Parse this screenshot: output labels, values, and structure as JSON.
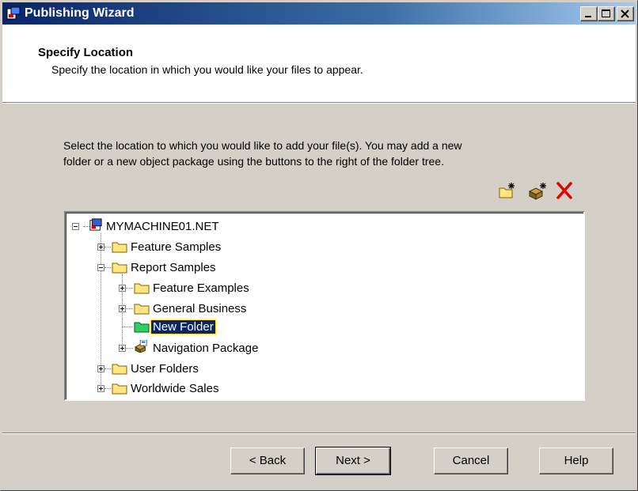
{
  "window": {
    "title": "Publishing Wizard"
  },
  "header": {
    "title": "Specify Location",
    "subtitle": "Specify the location in which you would like your files to appear."
  },
  "instructions": {
    "line1": "Select the location to which you would like to add your file(s).  You may add a new",
    "line2": "folder or a new object package using the buttons to the right of the folder tree."
  },
  "toolbar": {
    "icons": [
      "new-folder-icon",
      "new-package-icon",
      "delete-icon"
    ],
    "delete_color": "#e00000"
  },
  "tree": {
    "root": "MYMACHINE01.NET",
    "items": [
      {
        "label": "Feature Samples"
      },
      {
        "label": "Report Samples"
      },
      {
        "label": "Feature Examples"
      },
      {
        "label": "General Business"
      },
      {
        "label": "New Folder",
        "selected": true
      },
      {
        "label": "Navigation Package"
      },
      {
        "label": "User Folders"
      },
      {
        "label": "Worldwide Sales"
      }
    ]
  },
  "buttons": {
    "back": "< Back",
    "next": "Next >",
    "cancel": "Cancel",
    "help": "Help"
  },
  "colors": {
    "title_bar": "#0a246a",
    "selection": "#0a246a",
    "folder": "#ffe680",
    "new_folder": "#33cc66"
  }
}
